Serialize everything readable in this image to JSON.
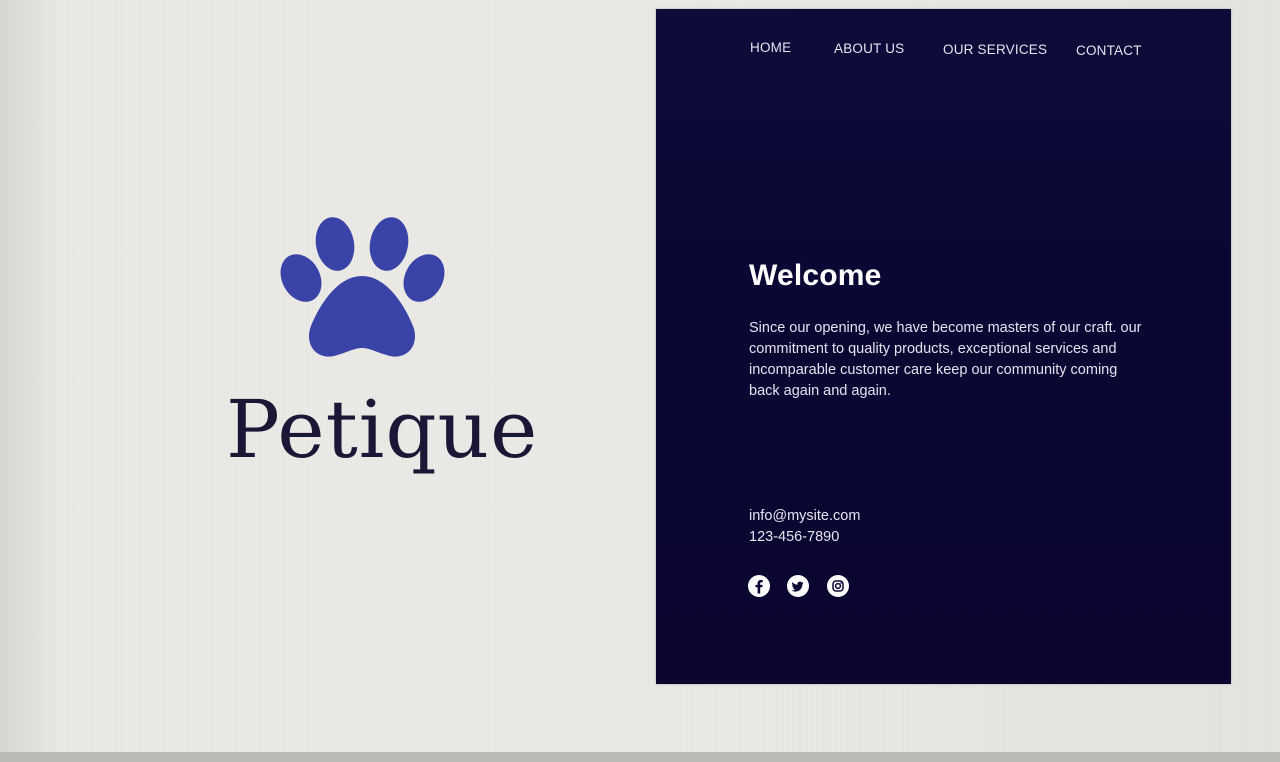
{
  "brand": {
    "name": "Petique",
    "logo_icon": "paw-print-icon",
    "logo_color": "#3a44a8"
  },
  "nav": {
    "items": [
      {
        "label": "HOME"
      },
      {
        "label": "ABOUT US"
      },
      {
        "label": "OUR SERVICES"
      },
      {
        "label": "CONTACT"
      }
    ]
  },
  "welcome": {
    "title": "Welcome",
    "body": "Since our opening, we have become masters of our craft. our commitment to quality products, exceptional services and incomparable customer care keep our community coming back again and again."
  },
  "contact": {
    "email": "info@mysite.com",
    "phone": "123-456-7890"
  },
  "social": [
    {
      "icon": "facebook-icon"
    },
    {
      "icon": "twitter-icon"
    },
    {
      "icon": "instagram-icon"
    }
  ],
  "colors": {
    "panel_background": "#0c0834",
    "page_background": "#eceae6",
    "brand_text": "#1b1736",
    "nav_text": "#e6e6ef"
  }
}
